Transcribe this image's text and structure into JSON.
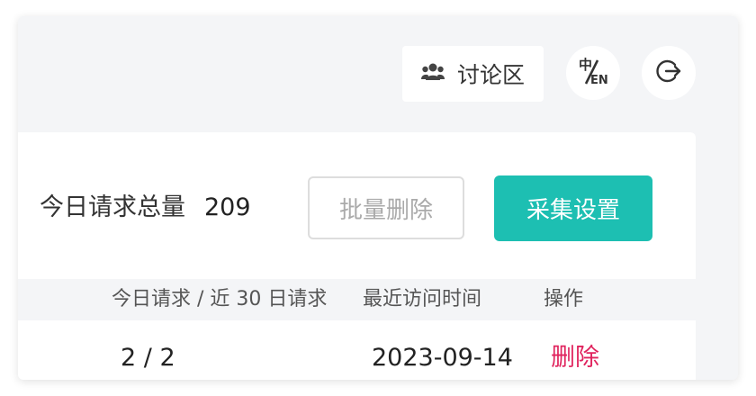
{
  "topbar": {
    "forum_label": "讨论区",
    "forum_icon": "users-icon",
    "lang_icon": "translate-zh-en-icon",
    "lang_glyph_zh": "中",
    "lang_glyph_en": "EN",
    "logout_icon": "logout-icon"
  },
  "summary": {
    "total_label": "今日请求总量",
    "total_value": "209"
  },
  "actions": {
    "batch_delete_label": "批量删除",
    "collect_settings_label": "采集设置"
  },
  "table": {
    "headers": [
      "今日请求 / 近 30 日请求",
      "最近访问时间",
      "操作"
    ],
    "rows": [
      {
        "requests": "2 / 2",
        "last_visit": "2023-09-14",
        "action": "删除"
      }
    ]
  },
  "colors": {
    "primary": "#1dbfb2",
    "danger": "#e0245e",
    "background": "#f4f5f7"
  }
}
